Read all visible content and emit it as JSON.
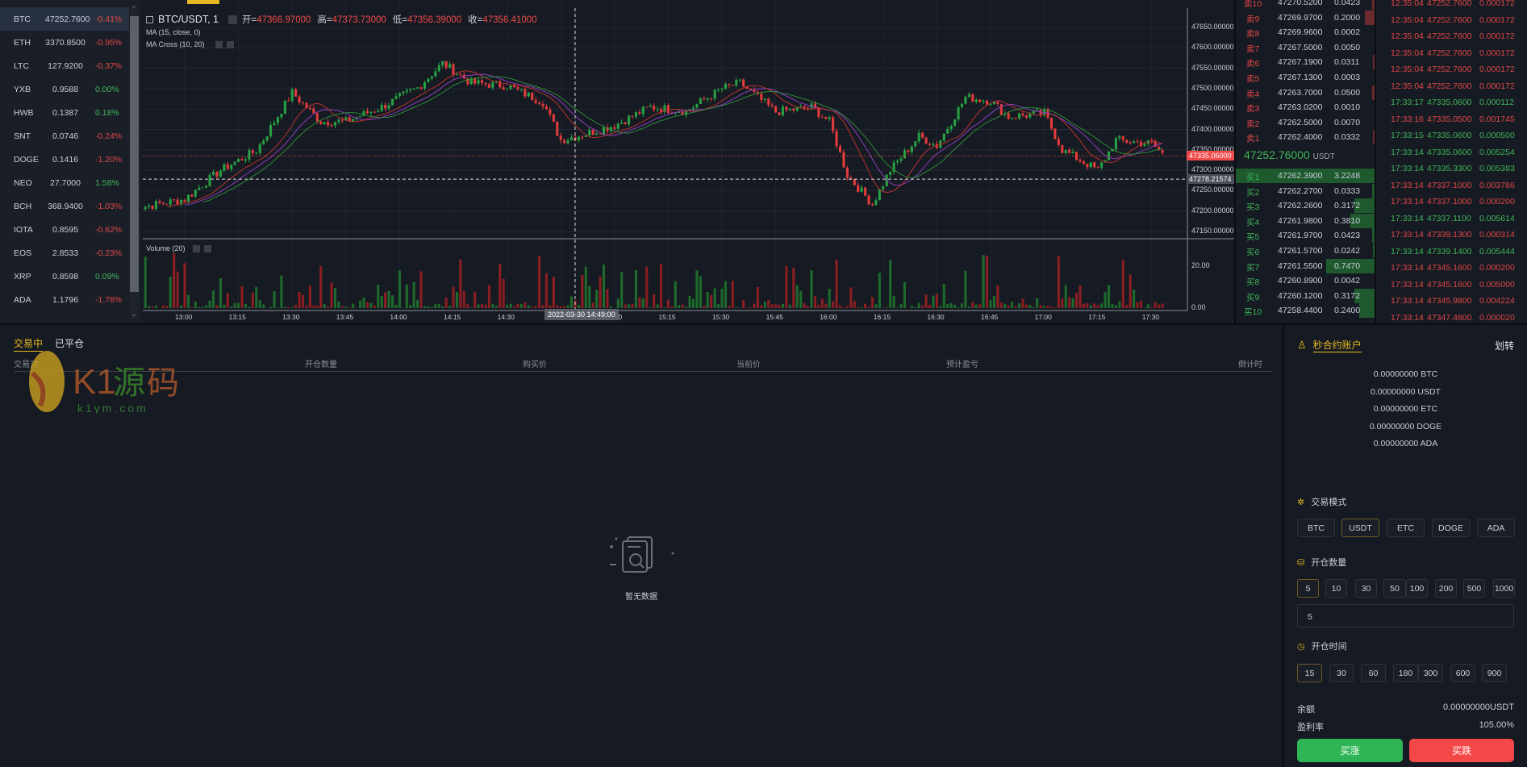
{
  "sidebar": {
    "items": [
      {
        "symbol": "BTC",
        "price": "47252.7600",
        "change": "-0.41%",
        "up": false,
        "active": true
      },
      {
        "symbol": "ETH",
        "price": "3370.8500",
        "change": "-0.95%",
        "up": false
      },
      {
        "symbol": "LTC",
        "price": "127.9200",
        "change": "-0.37%",
        "up": false
      },
      {
        "symbol": "YXB",
        "price": "0.9588",
        "change": "0.00%",
        "up": true
      },
      {
        "symbol": "HWB",
        "price": "0.1387",
        "change": "0.18%",
        "up": true
      },
      {
        "symbol": "SNT",
        "price": "0.0746",
        "change": "-0.24%",
        "up": false
      },
      {
        "symbol": "DOGE",
        "price": "0.1416",
        "change": "-1.20%",
        "up": false
      },
      {
        "symbol": "NEO",
        "price": "27.7000",
        "change": "1.58%",
        "up": true
      },
      {
        "symbol": "BCH",
        "price": "368.9400",
        "change": "-1.03%",
        "up": false
      },
      {
        "symbol": "IOTA",
        "price": "0.8595",
        "change": "-0.62%",
        "up": false
      },
      {
        "symbol": "EOS",
        "price": "2.8533",
        "change": "-0.23%",
        "up": false
      },
      {
        "symbol": "XRP",
        "price": "0.8598",
        "change": "0.09%",
        "up": true
      },
      {
        "symbol": "ADA",
        "price": "1.1796",
        "change": "-1.78%",
        "up": false
      }
    ]
  },
  "chart": {
    "title": "BTC/USDT, 1",
    "ohlc": [
      {
        "k": "开=",
        "v": "47366.97000"
      },
      {
        "k": "高=",
        "v": "47373.73000"
      },
      {
        "k": "低=",
        "v": "47356.39000"
      },
      {
        "k": "收=",
        "v": "47356.41000"
      }
    ],
    "study1": "MA (15, close, 0)",
    "study2": "MA Cross (10, 20)",
    "volume_label": "Volume (20)",
    "last_price_tag": "47335.06000",
    "crosshair_price_tag": "47278.21574",
    "crosshair_time_tag": "2022-03-30 14:49:00",
    "colors": {
      "up": "#26a042",
      "down": "#e23b3b",
      "ma15": "#8a3fbf",
      "ma10": "#b83232",
      "ma20": "#2f8a3a",
      "last": "#f04a4a"
    }
  },
  "chart_data": {
    "type": "candlestick",
    "price_ticks": [
      "47650.00000",
      "47600.00000",
      "47550.00000",
      "47500.00000",
      "47450.00000",
      "47400.00000",
      "47350.00000",
      "47300.00000",
      "47250.00000",
      "47200.00000",
      "47150.00000"
    ],
    "ylim": [
      47150,
      47650
    ],
    "volume_ticks": [
      "20.00",
      "0.00"
    ],
    "volume_ylim": [
      0,
      30
    ],
    "time_ticks": [
      "13:00",
      "13:15",
      "13:30",
      "13:45",
      "14:00",
      "14:15",
      "14:30",
      "14:45",
      "15:00",
      "15:15",
      "15:30",
      "15:45",
      "16:00",
      "16:15",
      "16:30",
      "16:45",
      "17:00",
      "17:15",
      "17:30"
    ],
    "close_path": [
      [
        "12:45",
        47205
      ],
      [
        "13:00",
        47229
      ],
      [
        "13:10",
        47300
      ],
      [
        "13:20",
        47348
      ],
      [
        "13:30",
        47490
      ],
      [
        "13:38",
        47419
      ],
      [
        "13:45",
        47420
      ],
      [
        "13:55",
        47455
      ],
      [
        "14:05",
        47502
      ],
      [
        "14:12",
        47562
      ],
      [
        "14:20",
        47514
      ],
      [
        "14:30",
        47507
      ],
      [
        "14:40",
        47467
      ],
      [
        "14:45",
        47374
      ],
      [
        "14:50",
        47385
      ],
      [
        "15:00",
        47410
      ],
      [
        "15:10",
        47455
      ],
      [
        "15:20",
        47445
      ],
      [
        "15:30",
        47500
      ],
      [
        "15:35",
        47514
      ],
      [
        "15:45",
        47443
      ],
      [
        "15:55",
        47455
      ],
      [
        "16:00",
        47419
      ],
      [
        "16:05",
        47288
      ],
      [
        "16:12",
        47217
      ],
      [
        "16:17",
        47300
      ],
      [
        "16:25",
        47383
      ],
      [
        "16:30",
        47360
      ],
      [
        "16:38",
        47479
      ],
      [
        "16:45",
        47470
      ],
      [
        "16:50",
        47431
      ],
      [
        "17:00",
        47440
      ],
      [
        "17:05",
        47350
      ],
      [
        "17:15",
        47300
      ],
      [
        "17:20",
        47374
      ],
      [
        "17:30",
        47365
      ],
      [
        "17:33",
        47340
      ]
    ]
  },
  "orderbook": {
    "asks": [
      [
        "卖10",
        "47270.5200",
        "0.0423"
      ],
      [
        "卖9",
        "47269.9700",
        "0.2000"
      ],
      [
        "卖8",
        "47269.9600",
        "0.0002"
      ],
      [
        "卖7",
        "47267.5000",
        "0.0050"
      ],
      [
        "卖6",
        "47267.1900",
        "0.0311"
      ],
      [
        "卖5",
        "47267.1300",
        "0.0003"
      ],
      [
        "卖4",
        "47263.7000",
        "0.0500"
      ],
      [
        "卖3",
        "47263.0200",
        "0.0010"
      ],
      [
        "卖2",
        "47262.5000",
        "0.0070"
      ],
      [
        "卖1",
        "47262.4000",
        "0.0332"
      ]
    ],
    "mid_price": "47252.76000",
    "mid_unit": "USDT",
    "bids": [
      [
        "买1",
        "47262.3900",
        "3.2248"
      ],
      [
        "买2",
        "47262.2700",
        "0.0333"
      ],
      [
        "买3",
        "47262.2600",
        "0.3172"
      ],
      [
        "买4",
        "47261.9800",
        "0.3810"
      ],
      [
        "买5",
        "47261.9700",
        "0.0423"
      ],
      [
        "买6",
        "47261.5700",
        "0.0242"
      ],
      [
        "买7",
        "47261.5500",
        "0.7470"
      ],
      [
        "买8",
        "47260.8900",
        "0.0042"
      ],
      [
        "买9",
        "47260.1200",
        "0.3172"
      ],
      [
        "买10",
        "47258.4400",
        "0.2400"
      ]
    ]
  },
  "trades": [
    [
      "12:35:04",
      "47252.7600",
      "0.000172",
      false
    ],
    [
      "12:35:04",
      "47252.7600",
      "0.000172",
      false
    ],
    [
      "12:35:04",
      "47252.7600",
      "0.000172",
      false
    ],
    [
      "12:35:04",
      "47252.7600",
      "0.000172",
      false
    ],
    [
      "12:35:04",
      "47252.7600",
      "0.000172",
      false
    ],
    [
      "12:35:04",
      "47252.7600",
      "0.000172",
      false
    ],
    [
      "17:33:17",
      "47335.0600",
      "0.000112",
      true
    ],
    [
      "17:33:16",
      "47335.0500",
      "0.001745",
      false
    ],
    [
      "17:33:15",
      "47335.0600",
      "0.000500",
      true
    ],
    [
      "17:33:14",
      "47335.0600",
      "0.005254",
      true
    ],
    [
      "17:33:14",
      "47335.3300",
      "0.005383",
      true
    ],
    [
      "17:33:14",
      "47337.1000",
      "0.003786",
      false
    ],
    [
      "17:33:14",
      "47337.1000",
      "0.000200",
      false
    ],
    [
      "17:33:14",
      "47337.1100",
      "0.005614",
      true
    ],
    [
      "17:33:14",
      "47339.1300",
      "0.000314",
      false
    ],
    [
      "17:33:14",
      "47339.1400",
      "0.005444",
      true
    ],
    [
      "17:33:14",
      "47345.1600",
      "0.000200",
      false
    ],
    [
      "17:33:14",
      "47345.1600",
      "0.005000",
      false
    ],
    [
      "17:33:14",
      "47345.9800",
      "0.004224",
      false
    ],
    [
      "17:33:14",
      "47347.4800",
      "0.000020",
      false
    ]
  ],
  "positions": {
    "tabs": [
      "交易中",
      "已平仓"
    ],
    "headers": [
      "交易对",
      "开仓数量",
      "购买价",
      "当前价",
      "预计盈亏",
      "倒计时"
    ],
    "empty_text": "暂无数据",
    "watermark": "K1源码 k1ym.com"
  },
  "account": {
    "title": "秒合约账户",
    "transfer": "划转",
    "balances": [
      "0.00000000 BTC",
      "0.00000000 USDT",
      "0.00000000 ETC",
      "0.00000000 DOGE",
      "0.00000000 ADA"
    ],
    "mode_label": "交易模式",
    "modes": [
      "BTC",
      "USDT",
      "ETC",
      "DOGE",
      "ADA"
    ],
    "mode_selected": "USDT",
    "amount_label": "开仓数量",
    "amounts": [
      "5",
      "10",
      "30",
      "50",
      "100",
      "200",
      "500",
      "1000"
    ],
    "amount_selected": "5",
    "amount_value": "5",
    "time_label": "开仓时间",
    "times": [
      "15",
      "30",
      "60",
      "180",
      "300",
      "600",
      "900"
    ],
    "time_selected": "15",
    "balance_label": "余额",
    "balance_value": "0.00000000USDT",
    "rate_label": "盈利率",
    "rate_value": "105.00%",
    "buy_up": "买涨",
    "buy_down": "买跌",
    "colors": {
      "accent": "#e8b923",
      "buy": "#2fb556",
      "sell": "#f44848"
    }
  }
}
